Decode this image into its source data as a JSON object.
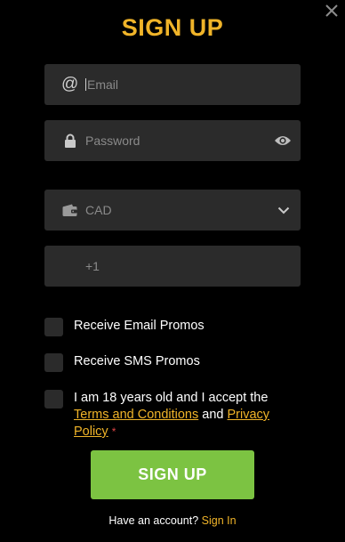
{
  "title": "SIGN UP",
  "form": {
    "email": {
      "placeholder": "Email",
      "icon": "at-icon"
    },
    "password": {
      "placeholder": "Password",
      "icon": "lock-icon",
      "toggle_icon": "eye-icon"
    },
    "currency": {
      "value": "CAD",
      "icon": "wallet-icon",
      "arrow_icon": "chevron-down-icon"
    },
    "phone": {
      "prefix": "+1"
    }
  },
  "checkboxes": {
    "email_promos": "Receive Email Promos",
    "sms_promos": "Receive SMS Promos",
    "terms": {
      "prefix": "I am 18 years old and I accept the",
      "terms_link": "Terms and Conditions",
      "and": "and",
      "privacy_link": "Privacy Policy",
      "required_mark": "*"
    }
  },
  "button": {
    "label": "SIGN UP"
  },
  "footer": {
    "text": "Have an account?",
    "link": "Sign In"
  },
  "colors": {
    "accent": "#f0b429",
    "button": "#7cc342",
    "field": "#2b2b2b",
    "background": "#000000"
  }
}
